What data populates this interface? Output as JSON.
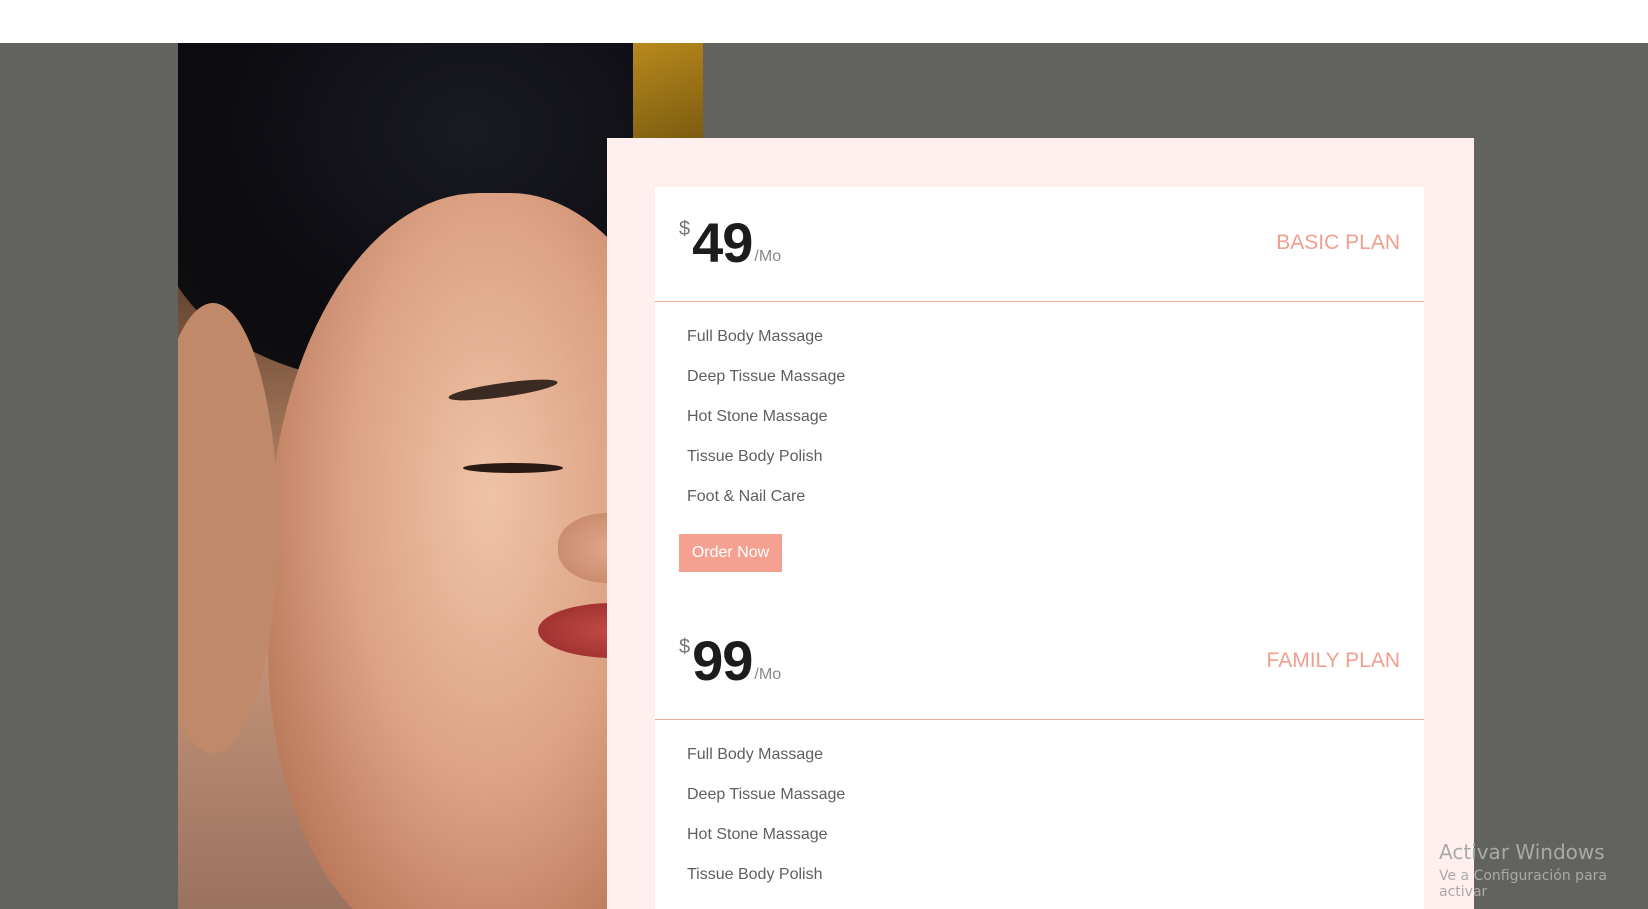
{
  "colors": {
    "accent": "#f5a192",
    "plan_name": "#f09f8f",
    "panel_background": "#fff0ef",
    "backdrop": "#62625f"
  },
  "hero_image": {
    "description_icon": "spa-face-photo"
  },
  "plans": [
    {
      "currency": "$",
      "amount": "49",
      "period": "/Mo",
      "name": "BASIC PLAN",
      "features": [
        "Full Body Massage",
        "Deep Tissue Massage",
        "Hot Stone Massage",
        "Tissue Body Polish",
        "Foot & Nail Care"
      ],
      "button_label": "Order Now"
    },
    {
      "currency": "$",
      "amount": "99",
      "period": "/Mo",
      "name": "FAMILY PLAN",
      "features": [
        "Full Body Massage",
        "Deep Tissue Massage",
        "Hot Stone Massage",
        "Tissue Body Polish"
      ]
    }
  ],
  "watermark": {
    "line1": "Activar Windows",
    "line2": "Ve a Configuración para activar"
  }
}
